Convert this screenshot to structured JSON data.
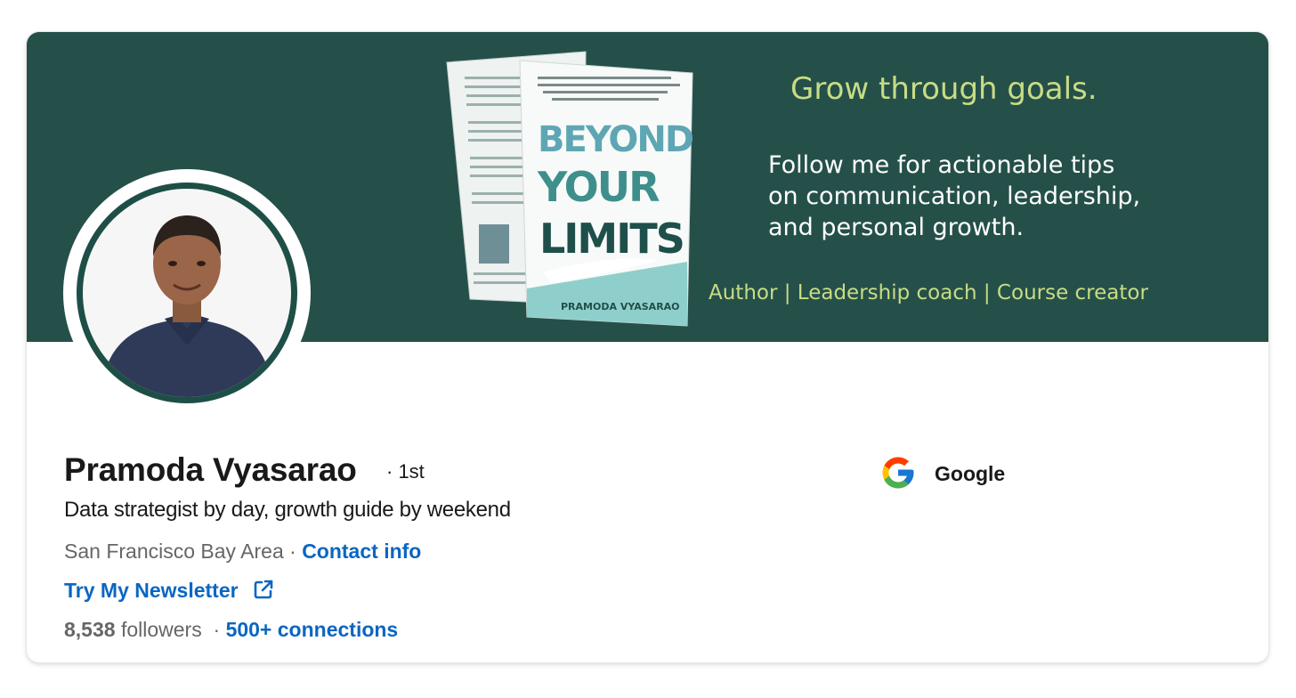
{
  "banner": {
    "heading": "Grow through goals.",
    "body_lines": [
      "Follow me for actionable tips",
      "on communication, leadership,",
      "and personal growth."
    ],
    "roles": "Author | Leadership coach | Course creator",
    "book": {
      "title_lines": [
        "BEYOND",
        "YOUR",
        "LIMITS"
      ],
      "author": "PRAMODA VYASARAO"
    }
  },
  "profile": {
    "name": "Pramoda Vyasarao",
    "degree": "· 1st",
    "headline": "Data strategist by day, growth guide by weekend",
    "location": "San Francisco Bay Area",
    "separator": "·",
    "contact_link": "Contact info",
    "newsletter_link": "Try My Newsletter",
    "followers_count": "8,538",
    "followers_label": "followers",
    "connections_link": "500+ connections"
  },
  "company": {
    "name": "Google",
    "icon": "google-logo"
  },
  "colors": {
    "banner_bg": "#25504a",
    "accent_green": "#c8dc84",
    "link_blue": "#0a66c2",
    "text_dark": "#191919",
    "text_muted": "#666666"
  }
}
